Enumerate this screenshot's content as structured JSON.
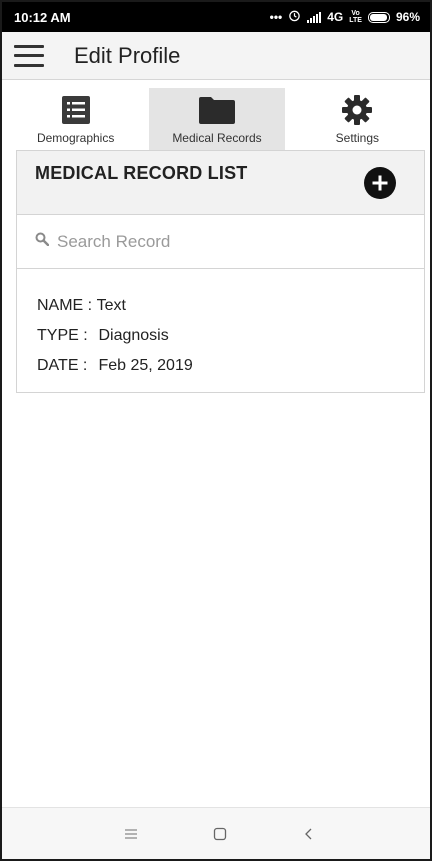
{
  "status_bar": {
    "time": "10:12 AM",
    "network": "4G",
    "battery": "96%",
    "icons": [
      "dots-icon",
      "alarm-icon",
      "signal-icon",
      "volte-icon",
      "battery-icon"
    ]
  },
  "app_bar": {
    "title": "Edit Profile",
    "menu_icon": "hamburger-menu-icon"
  },
  "tabs": [
    {
      "label": "Demographics",
      "icon": "list-icon",
      "selected": false
    },
    {
      "label": "Medical Records",
      "icon": "folder-icon",
      "selected": true
    },
    {
      "label": "Settings",
      "icon": "gear-icon",
      "selected": false
    }
  ],
  "medical_records": {
    "title": "MEDICAL RECORD LIST",
    "add_icon": "add-circle-icon",
    "search": {
      "placeholder": "Search Record",
      "value": ""
    },
    "records": [
      {
        "name_label": "NAME :",
        "name": "Text",
        "type_label": "TYPE :",
        "type": "Diagnosis",
        "date_label": "DATE :",
        "date": "Feb 25, 2019"
      }
    ]
  },
  "nav_bar": {
    "icons": [
      "recent-apps-icon",
      "home-icon",
      "back-icon"
    ]
  },
  "colors": {
    "status_bar_bg": "#000000",
    "app_bar_bg": "#f4f4f4",
    "selected_tab_bg": "#e4e4e4",
    "card_header_bg": "#f2f2f2",
    "accent": "#111111"
  }
}
